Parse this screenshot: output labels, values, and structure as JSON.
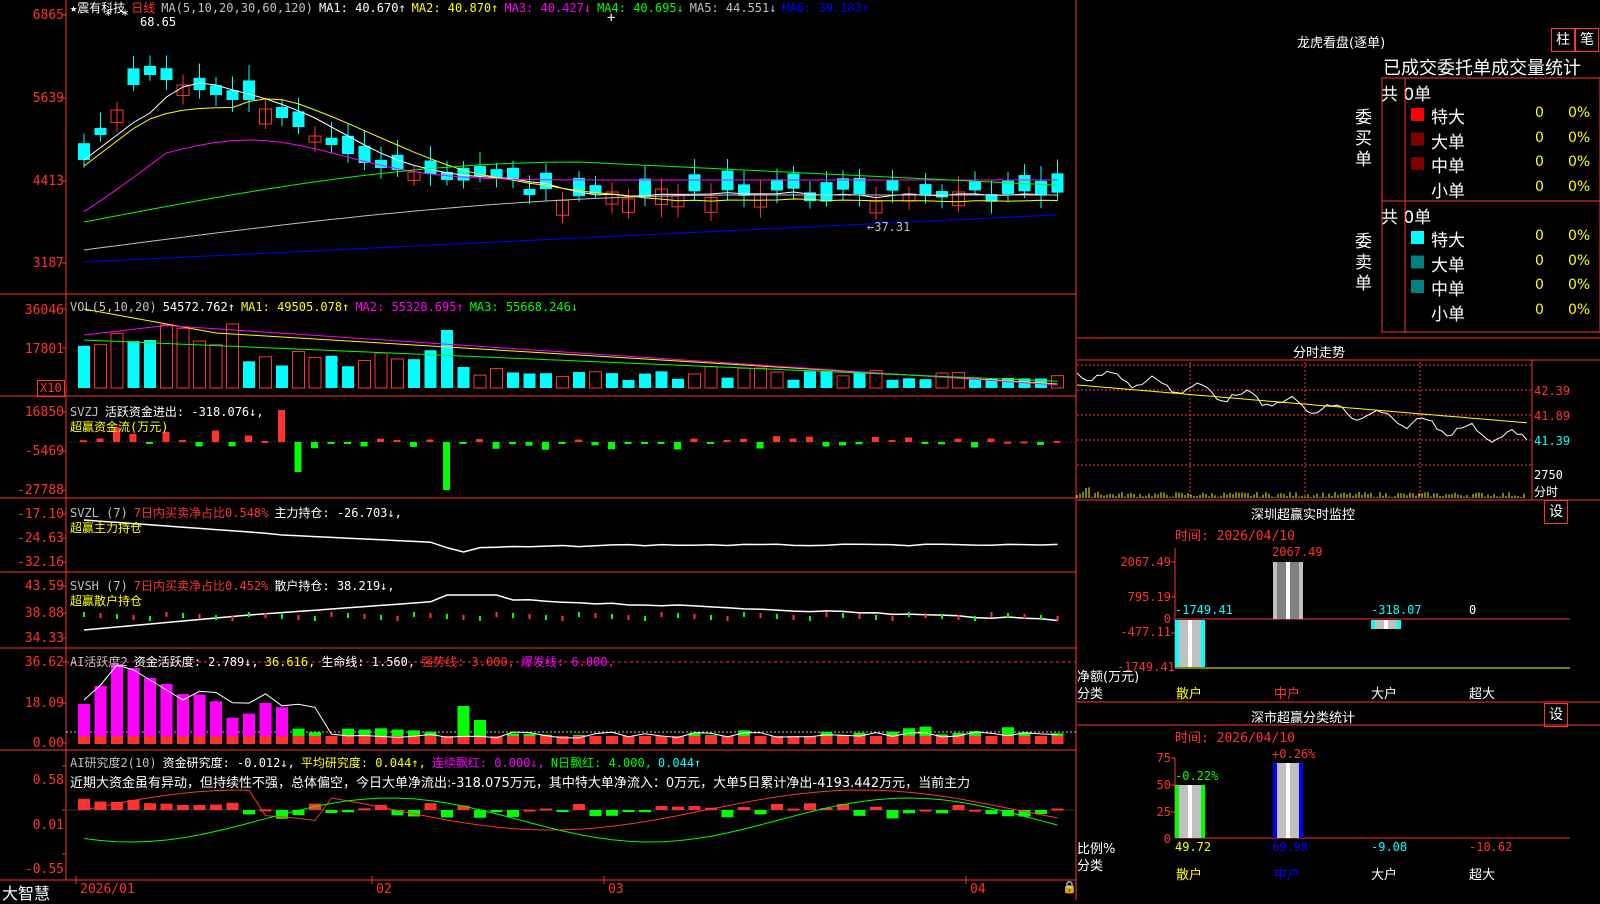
{
  "app": {
    "brand": "大智慧"
  },
  "colors": {
    "up": "#ff3232",
    "down": "#00ffff",
    "green": "#00ff00",
    "magenta": "#ff00ff",
    "yellow": "#ffff00",
    "white": "#ffffff",
    "grid": "#ff3232",
    "blue": "#0000ff"
  },
  "main": {
    "stock": "★震有科技",
    "period": "日线",
    "ma_label": "MA(5,10,20,30,60,120)",
    "ma1": "MA1: 40.670↑",
    "ma2": "MA2: 40.870↑",
    "ma3": "MA3: 40.427↓",
    "ma4": "MA4: 40.695↓",
    "ma5": "MA5: 44.551↓",
    "ma6": "MA6: 39.183↑",
    "high_mark": "68.65",
    "low_mark": "←37.31",
    "y_labels": [
      "6865",
      "5639",
      "4413",
      "3187"
    ]
  },
  "vol": {
    "title": "VOL(5,10,20)",
    "val": "54572.762↑",
    "ma1": "MA1: 49505.078↑",
    "ma2": "MA2: 55328.695↑",
    "ma3": "MA3: 55668.246↓",
    "y_labels": [
      "36046",
      "17801"
    ],
    "unit": "X10"
  },
  "svzj": {
    "title": "SVZJ",
    "line": "活跃资金进出: -318.076↓,",
    "sub": "超赢资金流(万元)",
    "y_labels": [
      "16850",
      "-5469",
      "-27788"
    ]
  },
  "svzl": {
    "title": "SVZL (7)",
    "a": "7日内买卖净占比0.548%",
    "b": "主力持仓: -26.703↓,",
    "sub": "超赢主力持仓",
    "y_labels": [
      "-17.10",
      "-24.63",
      "-32.16"
    ]
  },
  "svsh": {
    "title": "SVSH (7)",
    "a": "7日内买卖净占比0.452%",
    "b": "散户持仓: 38.219↓,",
    "sub": "超赢散户持仓",
    "y_labels": [
      "43.59",
      "38.88",
      "34.33"
    ]
  },
  "ai1": {
    "title": "AI活跃度2",
    "a": "资金活跃度: 2.789↓,",
    "b": "36.616,",
    "c": "生命线: 1.560,",
    "d": "强势线: 3.000,",
    "e": "爆发线: 6.000,",
    "y_labels": [
      "36.62",
      "18.09",
      "0.00"
    ]
  },
  "ai2": {
    "title": "AI研究度2(10)",
    "a": "资金研究度: -0.012↓,",
    "b": "平均研究度: 0.044↑,",
    "c": "连续飘红: 0.000↓,",
    "d": "N日飘红: 4.000,",
    "e": "0.044↑",
    "note": "近期大资金虽有异动，但持续性不强，总体偏空，今日大单净流出:-318.075万元，其中特大单净流入：0万元，大单5日累计净出-4193.442万元，当前主力",
    "y_labels": [
      "0.58",
      "0.01",
      "-0.55"
    ]
  },
  "xaxis": {
    "labels": [
      "2026/01",
      "02",
      "03",
      "04"
    ]
  },
  "dragon": {
    "title": "龙虎看盘(逐单)",
    "btn1": "柱",
    "btn2": "笔",
    "subtitle": "已成交委托单成交量统计",
    "buy_side": "委买单",
    "sell_side": "委卖单",
    "buy_total": "共 0单",
    "sell_total": "共 0单",
    "rows": [
      {
        "label": "特大",
        "count": "0",
        "pct": "0%"
      },
      {
        "label": "大单",
        "count": "0",
        "pct": "0%"
      },
      {
        "label": "中单",
        "count": "0",
        "pct": "0%"
      },
      {
        "label": "小单",
        "count": "0",
        "pct": "0%"
      }
    ]
  },
  "fenshi": {
    "title": "分时走势",
    "y_labels": [
      "42.39",
      "41.89",
      "41.39",
      "2750",
      "分时"
    ]
  },
  "sz_monitor": {
    "title": "深圳超赢实时监控",
    "btn": "设",
    "time": "时间: 2026/04/10",
    "y_labels": [
      "2067.49",
      "795.19",
      "0",
      "-477.11",
      "-1749.41"
    ],
    "y_title1": "净额(万元)",
    "y_title2": "分类",
    "values": [
      "-1749.41",
      "2067.49",
      "-318.07",
      "0"
    ],
    "cats": [
      "散户",
      "中户",
      "大户",
      "超大"
    ]
  },
  "sz_class": {
    "title": "深市超赢分类统计",
    "btn": "设",
    "time": "时间: 2026/04/10",
    "y_labels": [
      "75",
      "50",
      "25",
      "0"
    ],
    "y_title1": "比例%",
    "y_title2": "分类",
    "top_vals": [
      "-0.22%",
      "+0.26%"
    ],
    "bottom_vals": [
      "49.72",
      "69.98",
      "-9.08",
      "-10.62"
    ],
    "cats": [
      "散户",
      "中户",
      "大户",
      "超大"
    ]
  }
}
